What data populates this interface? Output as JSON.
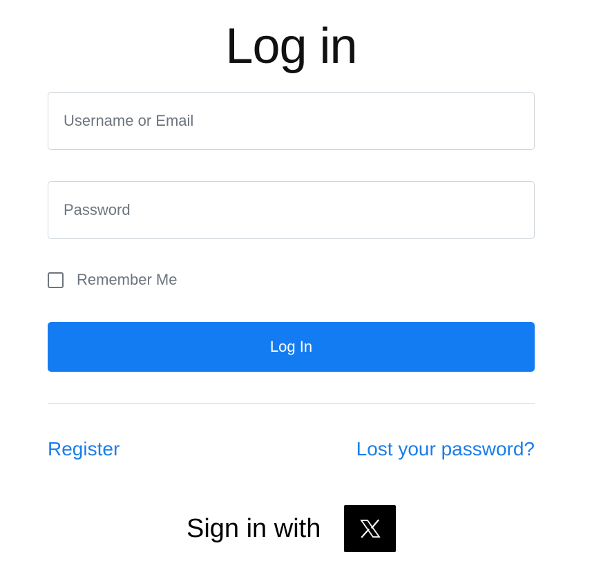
{
  "page": {
    "title": "Log in"
  },
  "form": {
    "username": {
      "placeholder": "Username or Email",
      "value": ""
    },
    "password": {
      "placeholder": "Password",
      "value": ""
    },
    "remember_me": {
      "label": "Remember Me",
      "checked": false
    },
    "submit_label": "Log In"
  },
  "links": {
    "register": "Register",
    "lost_password": "Lost your password?"
  },
  "social": {
    "label": "Sign in with",
    "provider_icon": "x-logo-icon"
  },
  "colors": {
    "primary": "#147cf2",
    "link": "#1a7ee8",
    "muted_text": "#6c757d",
    "border": "#ced4da",
    "social_button": "#000000"
  }
}
